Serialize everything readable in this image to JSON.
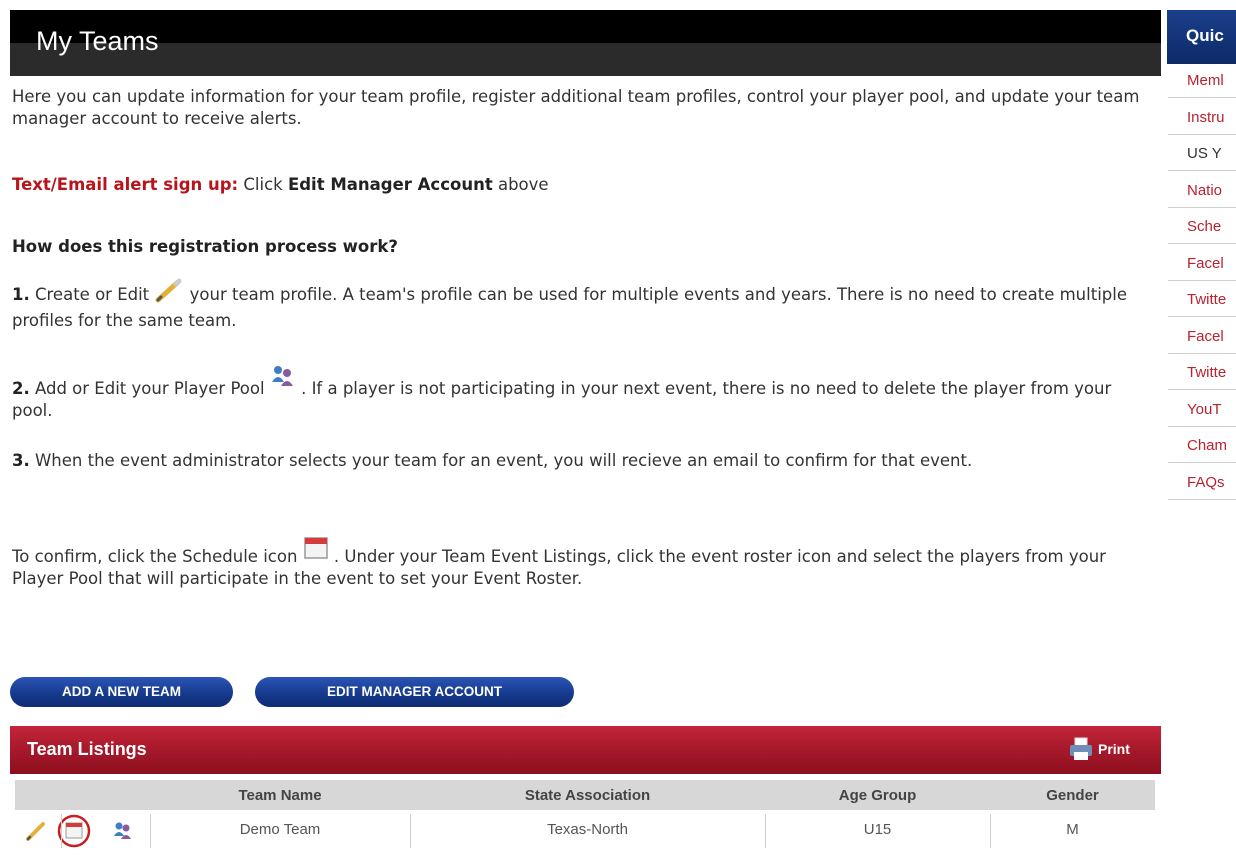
{
  "header": {
    "title": "My Teams"
  },
  "intro": {
    "text": "Here you can update information for your team profile, register additional team profiles, control your player pool, and update your team manager account to receive alerts."
  },
  "alert": {
    "label": "Text/Email alert sign up:",
    "text_before": " Click ",
    "link": "Edit Manager Account",
    "text_after": " above"
  },
  "process": {
    "heading": "How does this registration process work?",
    "step1": {
      "num": "1.",
      "before": " Create or Edit ",
      "after": " your team profile. A team's profile can be used for multiple events and years. There is no need to create multiple profiles for the same team.",
      "icon": "pencil-icon"
    },
    "step2": {
      "num": "2.",
      "before": " Add or Edit your Player Pool ",
      "after": " . If a player is not participating in your next event, there is no need to delete the player from your pool.",
      "icon": "players-icon"
    },
    "step3": {
      "num": "3.",
      "text": " When the event administrator selects your team for an event, you will recieve an email to confirm for that event."
    },
    "confirm": {
      "before": "To confirm, click the Schedule icon ",
      "after": " .  Under your Team Event Listings, click the event roster icon and select the players from your Player Pool that will participate in the event to set your Event Roster.",
      "icon": "calendar-icon"
    }
  },
  "buttons": {
    "add_team": "ADD A NEW TEAM",
    "edit_manager": "EDIT MANAGER ACCOUNT"
  },
  "listings": {
    "title": "Team Listings",
    "print_label": "Print",
    "columns": [
      "Team Name",
      "State Association",
      "Age Group",
      "Gender"
    ],
    "rows": [
      {
        "team_name": "Demo Team",
        "state_association": "Texas-North",
        "age_group": "U15",
        "gender": "M"
      }
    ]
  },
  "quick_links": {
    "title": "Quic",
    "items": [
      "Meml",
      "Instru",
      "US Y",
      "Natio",
      "Sche",
      "Facel",
      "Twitte",
      "Facel",
      "Twitte",
      "YouT",
      "Cham",
      "FAQs"
    ]
  },
  "colors": {
    "header_bg": "#000000",
    "alert_red": "#b8141c",
    "button_blue": "#163a8e",
    "listing_red": "#a91a2c",
    "quick_blue": "#1b3f8a",
    "link_red": "#b8232f"
  }
}
